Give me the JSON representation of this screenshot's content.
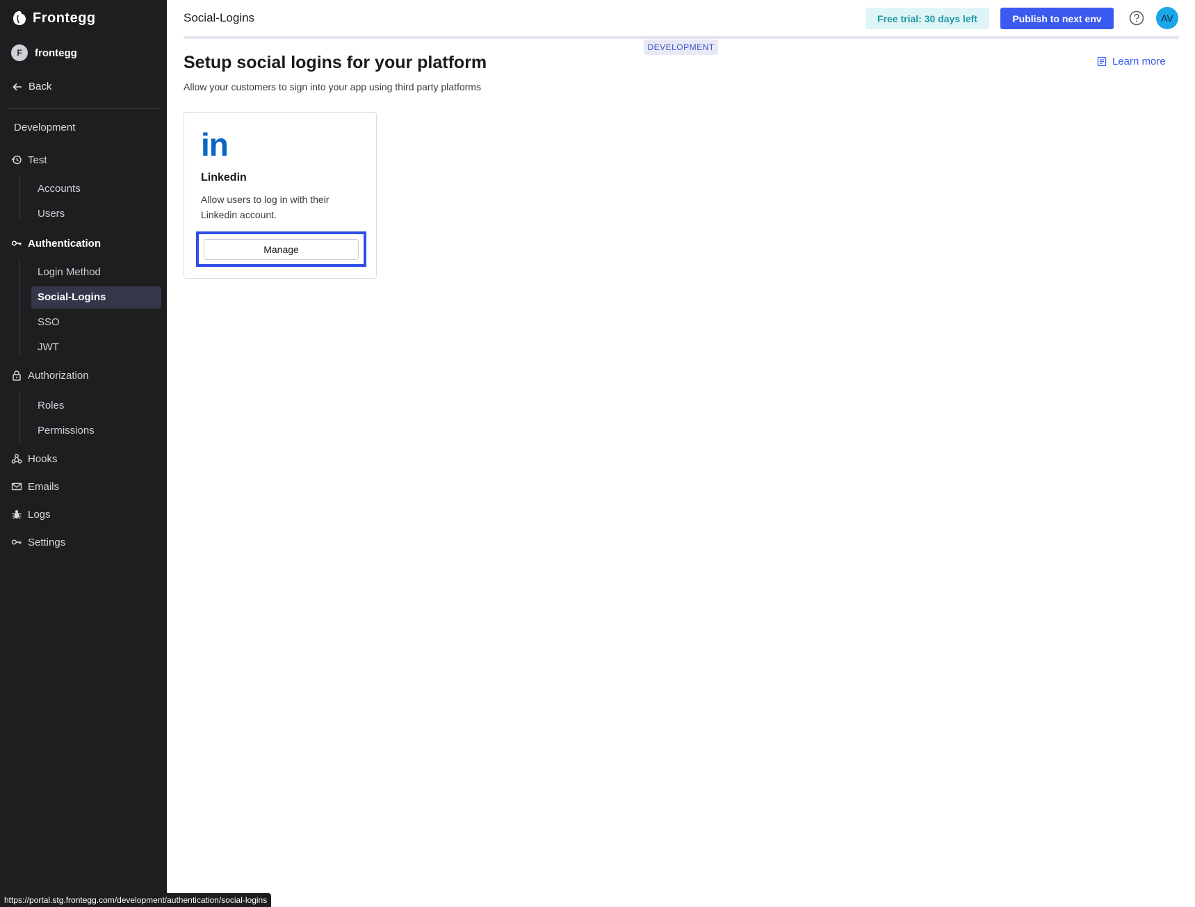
{
  "brand": {
    "name": "Frontegg"
  },
  "workspace": {
    "initial": "F",
    "name": "frontegg"
  },
  "sidebar": {
    "back_label": "Back",
    "env_label": "Development",
    "groups": [
      {
        "label": "Test",
        "icon": "history-icon",
        "items": [
          "Accounts",
          "Users"
        ]
      },
      {
        "label": "Authentication",
        "icon": "key-icon",
        "items": [
          "Login Method",
          "Social-Logins",
          "SSO",
          "JWT"
        ]
      },
      {
        "label": "Authorization",
        "icon": "lock-icon",
        "items": [
          "Roles",
          "Permissions"
        ]
      },
      {
        "label": "Hooks",
        "icon": "webhook-icon"
      },
      {
        "label": "Emails",
        "icon": "mail-icon"
      },
      {
        "label": "Logs",
        "icon": "bug-icon"
      },
      {
        "label": "Settings",
        "icon": "key-icon"
      }
    ]
  },
  "header": {
    "title": "Social-Logins",
    "trial_label": "Free trial: 30 days left",
    "publish_label": "Publish to next env",
    "user_initials": "AV",
    "env_badge": "DEVELOPMENT"
  },
  "main": {
    "title": "Setup social logins for your platform",
    "subtitle": "Allow your customers to sign into your app using third party platforms",
    "learn_more": "Learn more",
    "card": {
      "logo_text": "in",
      "title": "Linkedin",
      "description": "Allow users to log in with their Linkedin account.",
      "button_label": "Manage"
    }
  },
  "status_bar": {
    "url": "https://portal.stg.frontegg.com/development/authentication/social-logins"
  },
  "colors": {
    "sidebar_bg": "#1e1e20",
    "accent": "#3a5af0",
    "trial_bg": "#dff4f6",
    "linkedin": "#0a66c2",
    "focus": "#2f4fe6"
  }
}
